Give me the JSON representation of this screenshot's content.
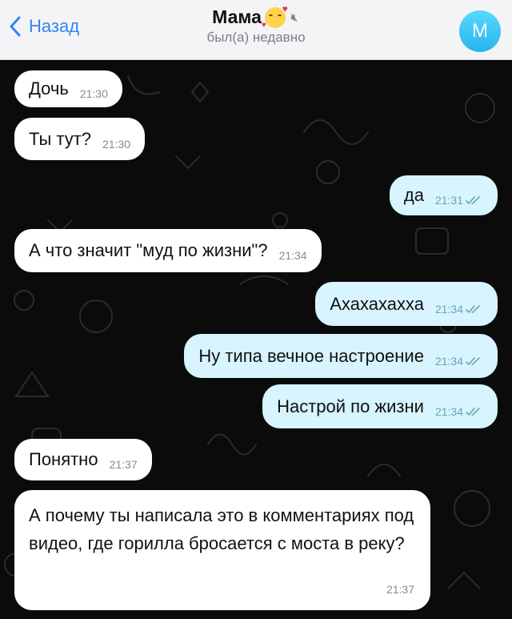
{
  "header": {
    "back_label": "Назад",
    "contact_name": "Мама",
    "status": "был(а) недавно",
    "avatar_letter": "М",
    "accent": "#2f86f6"
  },
  "messages": [
    {
      "dir": "in",
      "text": "Дочь",
      "time": "21:30"
    },
    {
      "dir": "in",
      "text": "Ты тут?",
      "time": "21:30"
    },
    {
      "dir": "out",
      "text": "да",
      "time": "21:31",
      "read": true
    },
    {
      "dir": "in",
      "text": "А что значит \"муд по жизни\"?",
      "time": "21:34"
    },
    {
      "dir": "out",
      "text": "Ахахахахха",
      "time": "21:34",
      "read": true
    },
    {
      "dir": "out",
      "text": "Ну типа вечное настроение",
      "time": "21:34",
      "read": true
    },
    {
      "dir": "out",
      "text": "Настрой по жизни",
      "time": "21:34",
      "read": true
    },
    {
      "dir": "in",
      "text": "Понятно",
      "time": "21:37"
    },
    {
      "dir": "in",
      "text": "А почему ты написала это в комментариях под видео, где горилла бросается с моста в реку?",
      "time": "21:37"
    }
  ]
}
